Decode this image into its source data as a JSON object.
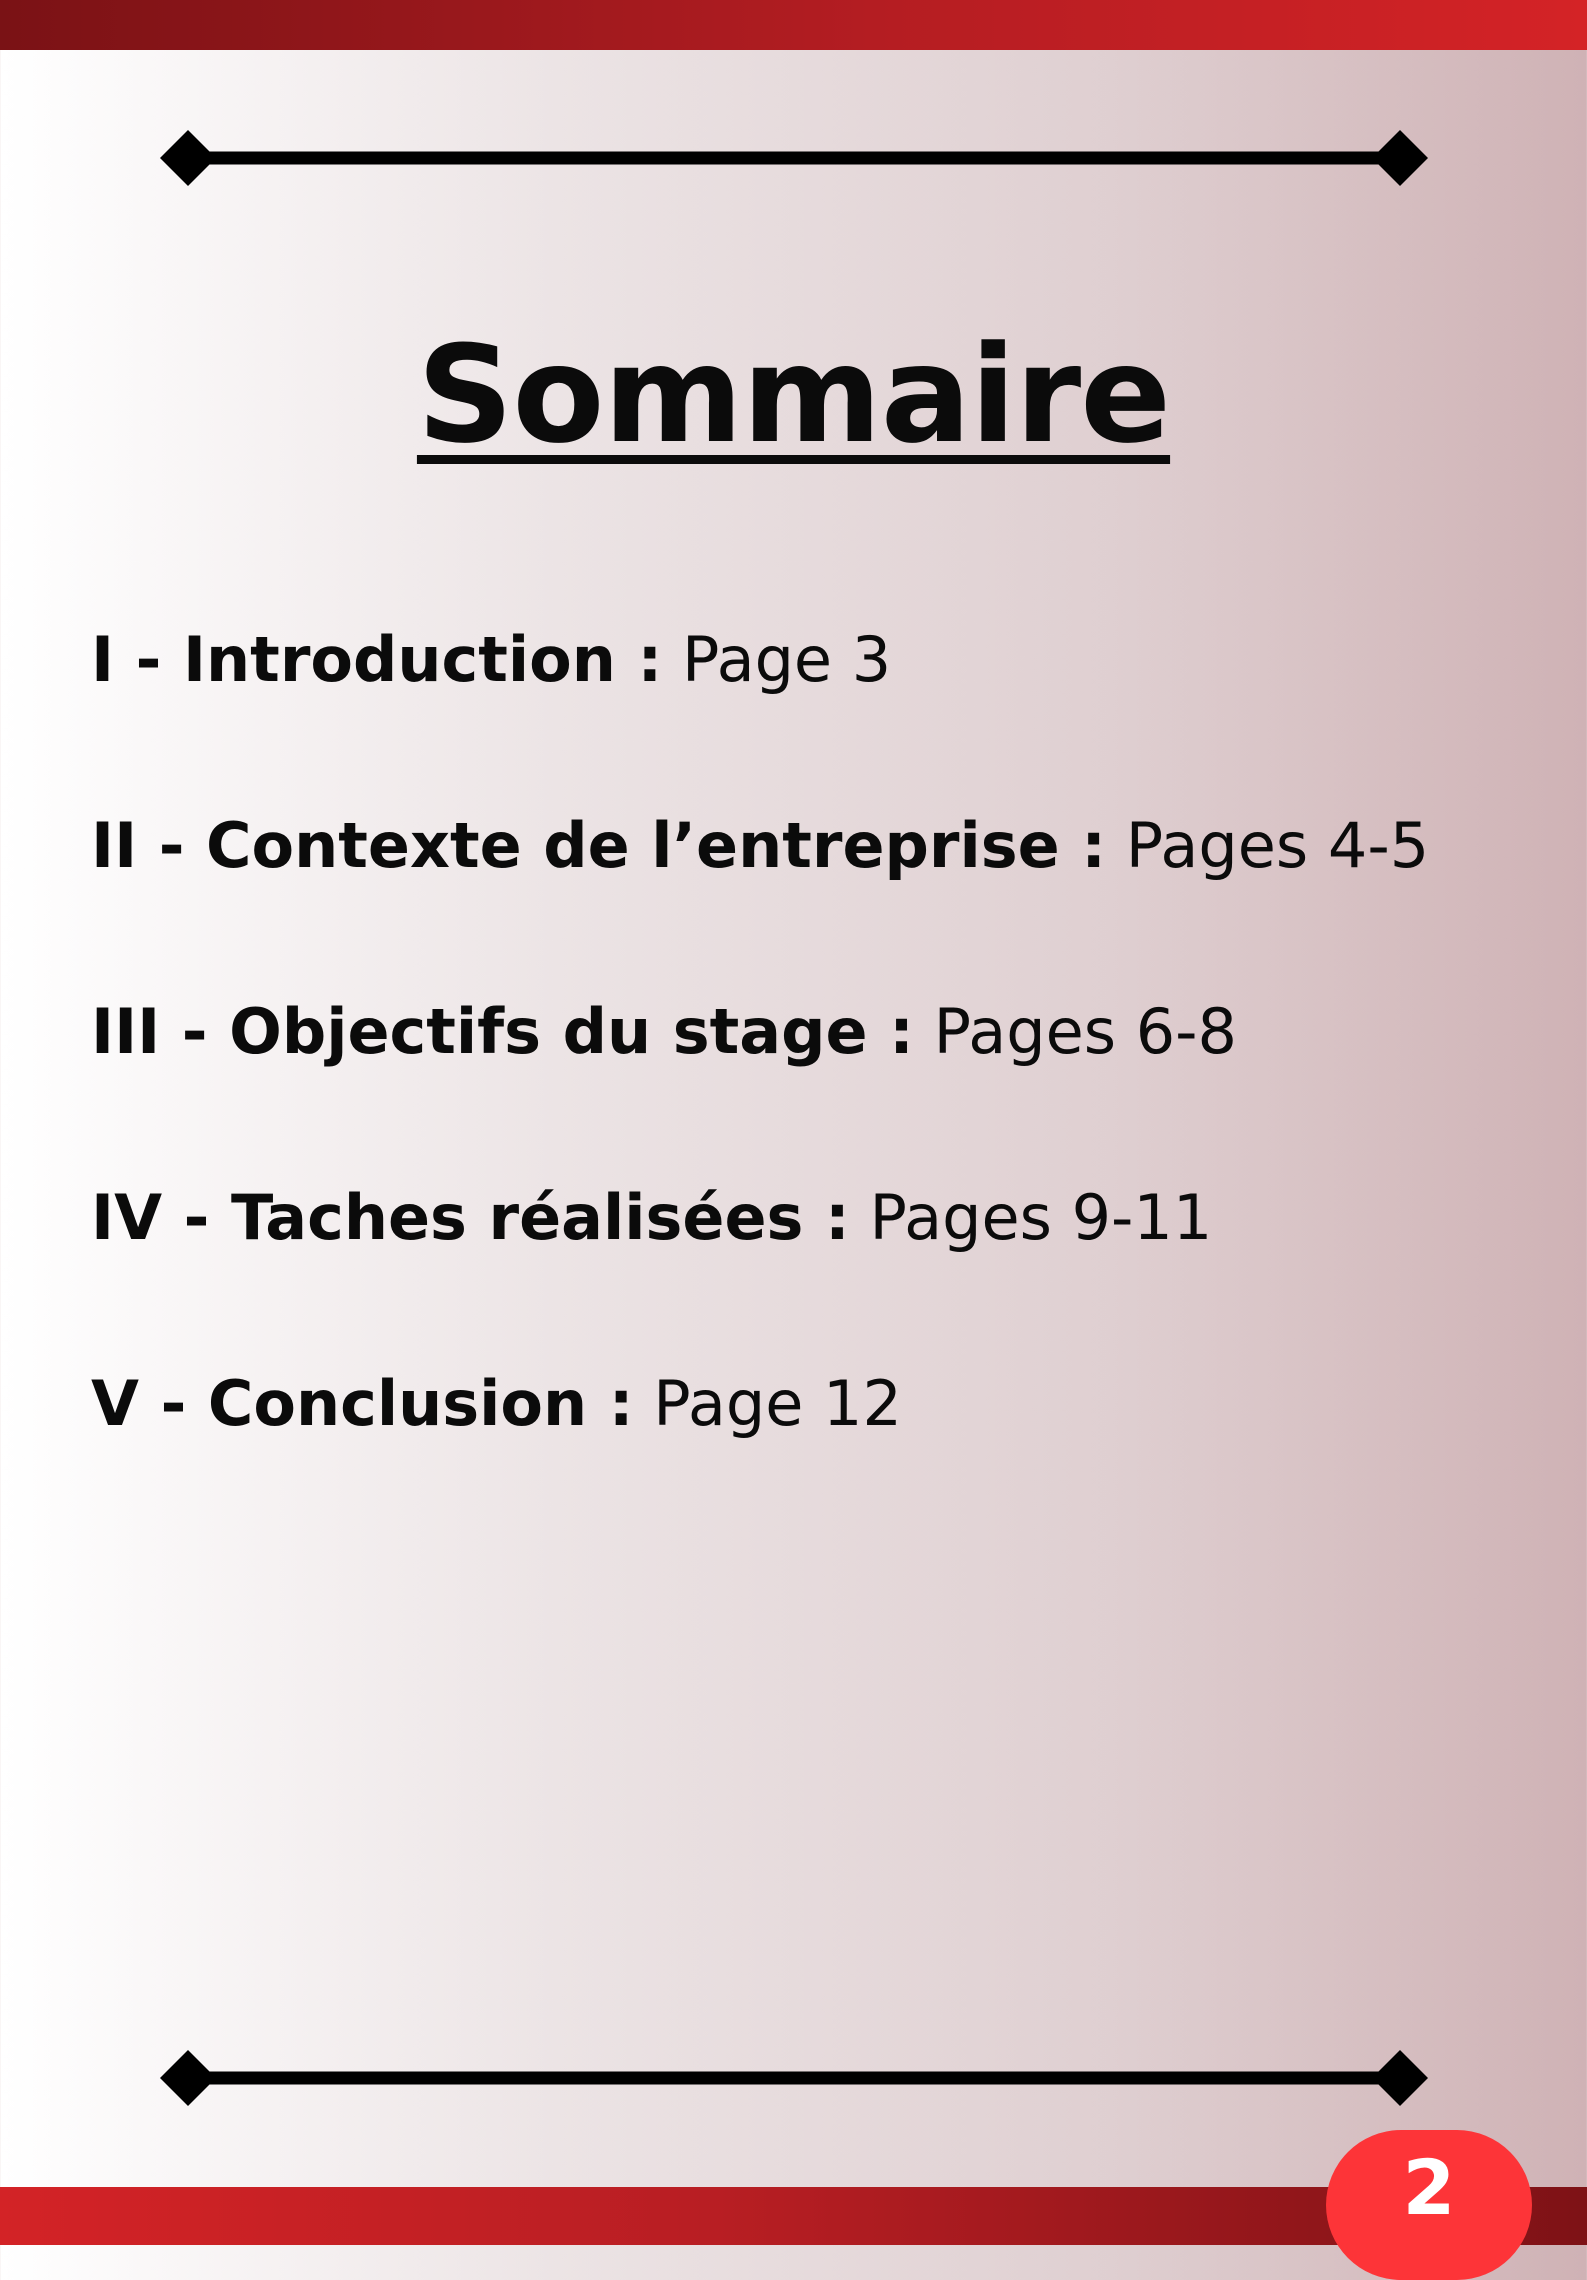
{
  "page": {
    "title": "Sommaire",
    "page_number": "2"
  },
  "toc": [
    {
      "label": "I - Introduction :",
      "pages": "Page 3"
    },
    {
      "label": "II - Contexte de l’entreprise :",
      "pages": "Pages 4-5"
    },
    {
      "label": "III - Objectifs du stage :",
      "pages": "Pages 6-8"
    },
    {
      "label": "IV - Taches réalisées :",
      "pages": "Pages 9-11"
    },
    {
      "label": "V - Conclusion :",
      "pages": "Page 12"
    }
  ],
  "colors": {
    "band_dark": "#7a1215",
    "band_bright": "#d42326",
    "badge": "#fd3438",
    "text": "#0b0b0b"
  }
}
